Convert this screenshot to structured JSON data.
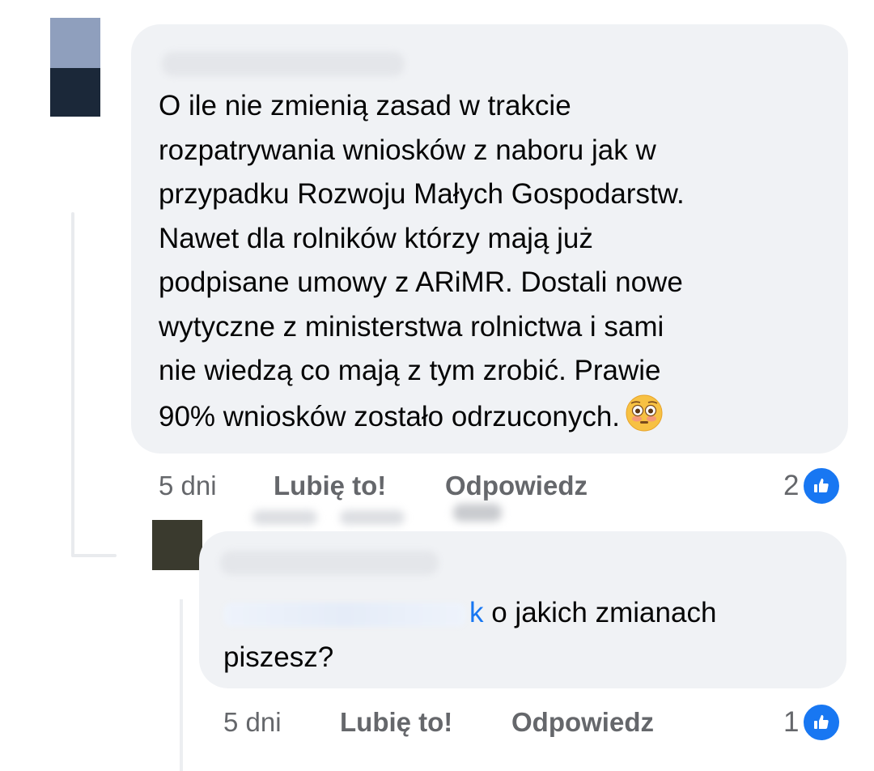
{
  "comments": [
    {
      "text": "O ile nie zmienią zasad w trakcie\nrozpatrywania wniosków z naboru jak w\nprzypadku Rozwoju Małych Gospodarstw.\nNawet dla rolników którzy mają już\npodpisane umowy z ARiMR. Dostali nowe\nwytyczne z ministerstwa rolnictwa i sami\nnie wiedzą co mają z tym zrobić. Prawie\n90% wniosków zostało odrzuconych.",
      "emoji": "flushed-face",
      "time": "5 dni",
      "like_label": "Lubię to!",
      "reply_label": "Odpowiedz",
      "reaction_count": "2"
    },
    {
      "mention_visible": "k",
      "text": " o jakich zmianach\npiszesz?",
      "time": "5 dni",
      "like_label": "Lubię to!",
      "reply_label": "Odpowiedz",
      "reaction_count": "1"
    }
  ],
  "colors": {
    "bubble": "#f0f2f5",
    "like_blue": "#1877f2",
    "meta_grey": "#65676b"
  }
}
